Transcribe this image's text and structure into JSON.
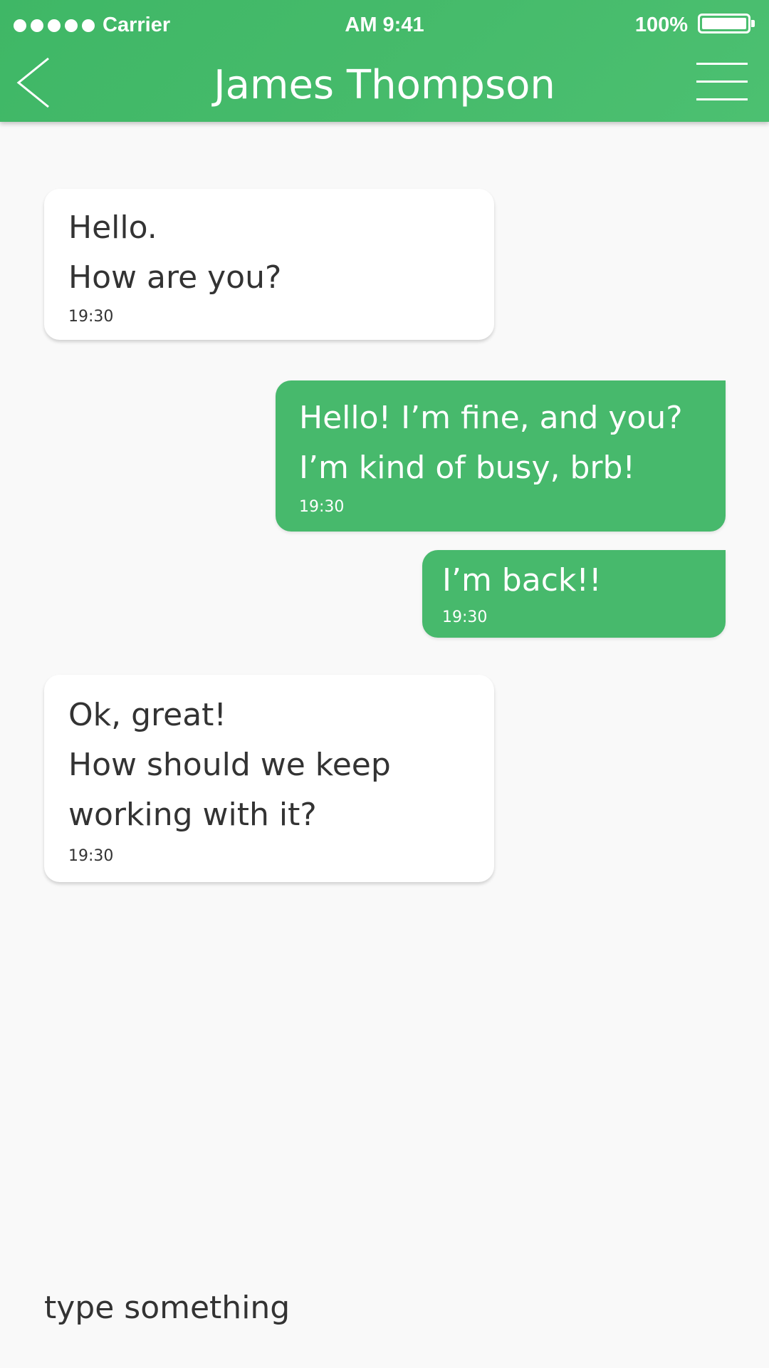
{
  "status_bar": {
    "carrier": "Carrier",
    "time": "AM 9:41",
    "battery_percent": "100%",
    "battery_level": 1.0,
    "signal_bars": 5
  },
  "header": {
    "title": "James Thompson",
    "back_icon": "chevron-left-icon",
    "menu_icon": "hamburger-menu-icon"
  },
  "messages": [
    {
      "direction": "incoming",
      "lines": [
        "Hello.",
        "How are you?"
      ],
      "time": "19:30"
    },
    {
      "direction": "outgoing",
      "lines": [
        "Hello! I’m fine, and you?",
        "I’m kind of busy, brb!"
      ],
      "time": "19:30"
    },
    {
      "direction": "outgoing",
      "lines": [
        "I’m back!!"
      ],
      "time": "19:30"
    },
    {
      "direction": "incoming",
      "lines": [
        "Ok, great!",
        "How should we keep",
        "working with it?"
      ],
      "time": "19:30"
    }
  ],
  "composer": {
    "placeholder": "type something",
    "value": ""
  },
  "colors": {
    "accent": "#47b96c",
    "background": "#f9f9f9",
    "incoming_bubble": "#ffffff",
    "text_dark": "#333333"
  }
}
